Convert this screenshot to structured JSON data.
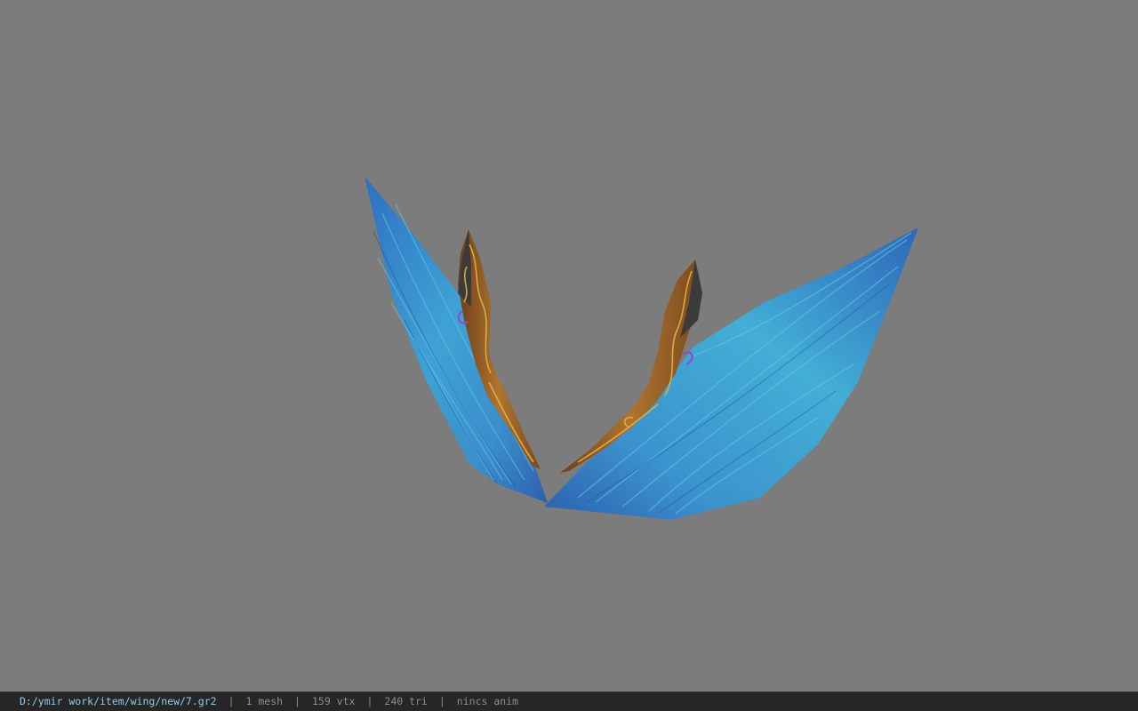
{
  "viewport": {
    "background": "#7c7c7c",
    "model_name": "wing"
  },
  "statusbar": {
    "file_path": "D:/ymir work/item/wing/new/7.gr2",
    "separator": "|",
    "mesh_count": "1 mesh",
    "vertex_count": "159 vtx",
    "triangle_count": "240 tri",
    "animation": "nincs anim"
  },
  "colors": {
    "feather_dark": "#2a62b6",
    "feather_light": "#4ab4d8",
    "bone_bronze": "#a86a2e",
    "ornament_gold": "#e0b040",
    "status_path": "#8fcbe8"
  }
}
